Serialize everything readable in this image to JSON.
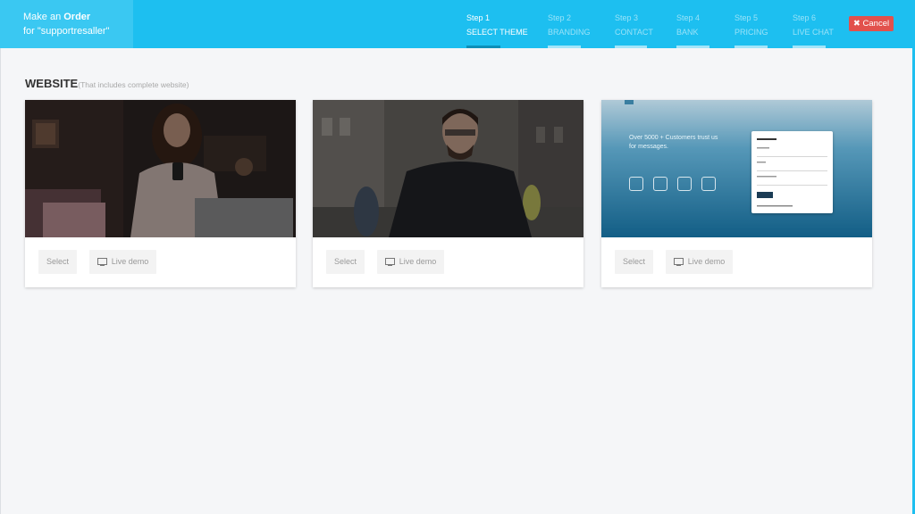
{
  "header": {
    "prefix": "Make an ",
    "title_bold": "Order",
    "subtitle": "for \"supportresaller\"",
    "cancel_label": "Cancel",
    "steps": [
      {
        "num": "Step 1",
        "label": "SELECT THEME",
        "active": true
      },
      {
        "num": "Step 2",
        "label": "BRANDING",
        "active": false
      },
      {
        "num": "Step 3",
        "label": "CONTACT",
        "active": false
      },
      {
        "num": "Step 4",
        "label": "BANK",
        "active": false
      },
      {
        "num": "Step 5",
        "label": "PRICING",
        "active": false
      },
      {
        "num": "Step 6",
        "label": "LIVE CHAT",
        "active": false
      }
    ]
  },
  "section": {
    "title": "WEBSITE",
    "subtitle": "(That includes complete website)"
  },
  "cards": [
    {
      "select_label": "Select",
      "demo_label": "Live demo",
      "thumb": "woman-with-phone-photo"
    },
    {
      "select_label": "Select",
      "demo_label": "Live demo",
      "thumb": "man-with-phone-photo"
    },
    {
      "select_label": "Select",
      "demo_label": "Live demo",
      "thumb": "login-page-preview"
    }
  ],
  "thumb3": {
    "headline_line1": "Over 5000 + Customers trust us",
    "headline_line2": "for messages."
  },
  "colors": {
    "header_bg": "#1dbff0",
    "cancel_bg": "#e2514c",
    "active_underline": "#0d8fb8"
  }
}
